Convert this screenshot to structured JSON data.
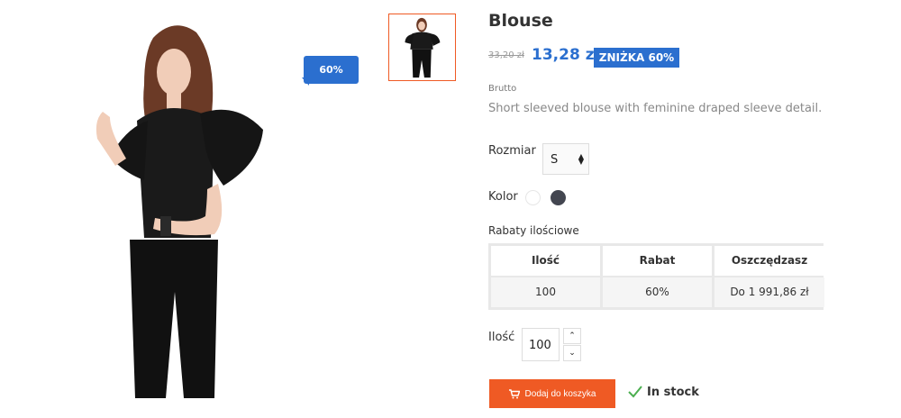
{
  "product": {
    "name": "Blouse",
    "old_price": "33,20 zł",
    "price": "13,28 zł",
    "discount_badge": "ZNIŻKA 60%",
    "discount_flag": "60%",
    "tax_label": "Brutto",
    "short_description": "Short sleeved blouse with feminine draped sleeve detail."
  },
  "images": {
    "main_icon": "model-wearing-black-blouse",
    "thumbnail_icon": "model-wearing-black-blouse"
  },
  "variants": {
    "size_label": "Rozmiar",
    "size_selected": "S",
    "color_label": "Kolor",
    "colors": [
      "#ffffff",
      "#434650"
    ]
  },
  "volume_discounts": {
    "title": "Rabaty ilościowe",
    "headers": [
      "Ilość",
      "Rabat",
      "Oszczędzasz"
    ],
    "rows": [
      [
        "100",
        "60%",
        "Do 1 991,86 zł"
      ]
    ]
  },
  "quantity": {
    "label": "Ilość",
    "value": "100"
  },
  "cart": {
    "button_label": "Dodaj do koszyka",
    "button_color": "#ef5a24"
  },
  "stock": {
    "label": "In stock",
    "icon": "check-icon",
    "icon_color": "#4caf50"
  },
  "accent_color": "#2b6fcf"
}
